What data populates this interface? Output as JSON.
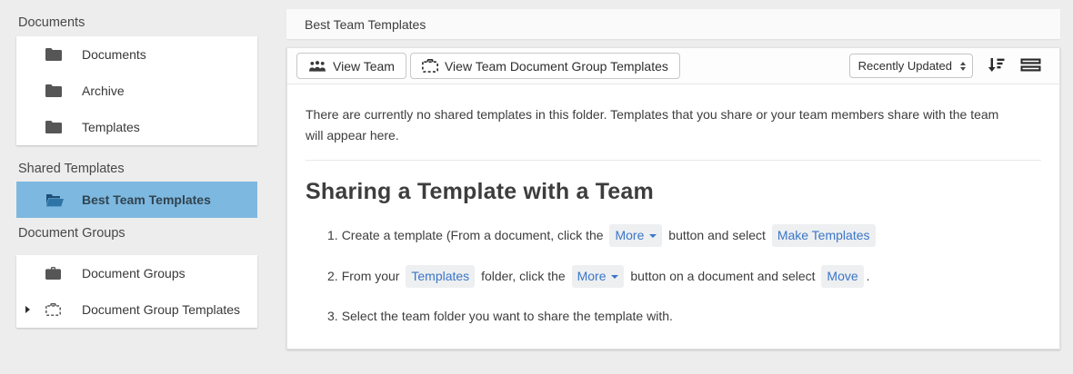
{
  "colors": {
    "page_bg": "#ededed",
    "selected_item_bg": "#7db8e0",
    "link_blue": "#3b76c7",
    "chip_bg": "#edeff1"
  },
  "sidebar": {
    "sections": [
      {
        "title": "Documents",
        "items": [
          {
            "label": "Documents",
            "icon": "folder-icon"
          },
          {
            "label": "Archive",
            "icon": "folder-icon"
          },
          {
            "label": "Templates",
            "icon": "folder-icon"
          }
        ]
      },
      {
        "title": "Shared Templates",
        "items": [
          {
            "label": "Best Team Templates",
            "icon": "open-folder-icon",
            "selected": true
          }
        ]
      },
      {
        "title": "Document Groups",
        "items": [
          {
            "label": "Document Groups",
            "icon": "briefcase-icon"
          },
          {
            "label": "Document Group Templates",
            "icon": "briefcase-dashed-icon",
            "expandable": true
          }
        ]
      }
    ]
  },
  "header": {
    "breadcrumb": "Best Team Templates"
  },
  "toolbar": {
    "view_team_label": "View Team",
    "view_team_doc_group_templates_label": "View Team Document Group Templates",
    "sort_select_value": "Recently Updated",
    "icons": [
      "sort-descending-icon",
      "list-view-icon"
    ]
  },
  "content": {
    "empty_message": "There are currently no shared templates in this folder. Templates that you share or your team members share with the team will appear here.",
    "section_heading": "Sharing a Template with a Team",
    "steps": {
      "s1": {
        "num": "1.",
        "t1": "Create a template (From a document, click the",
        "more_label": "More",
        "t2": "button and select",
        "make_templates_label": "Make Templates"
      },
      "s2": {
        "num": "2.",
        "t1": "From your",
        "templates_label": "Templates",
        "t2": "folder, click the",
        "more_label": "More",
        "t3": "button on a document and select",
        "move_label": "Move",
        "t4": "."
      },
      "s3": {
        "num": "3.",
        "t1": "Select the team folder you want to share the template with."
      }
    }
  }
}
